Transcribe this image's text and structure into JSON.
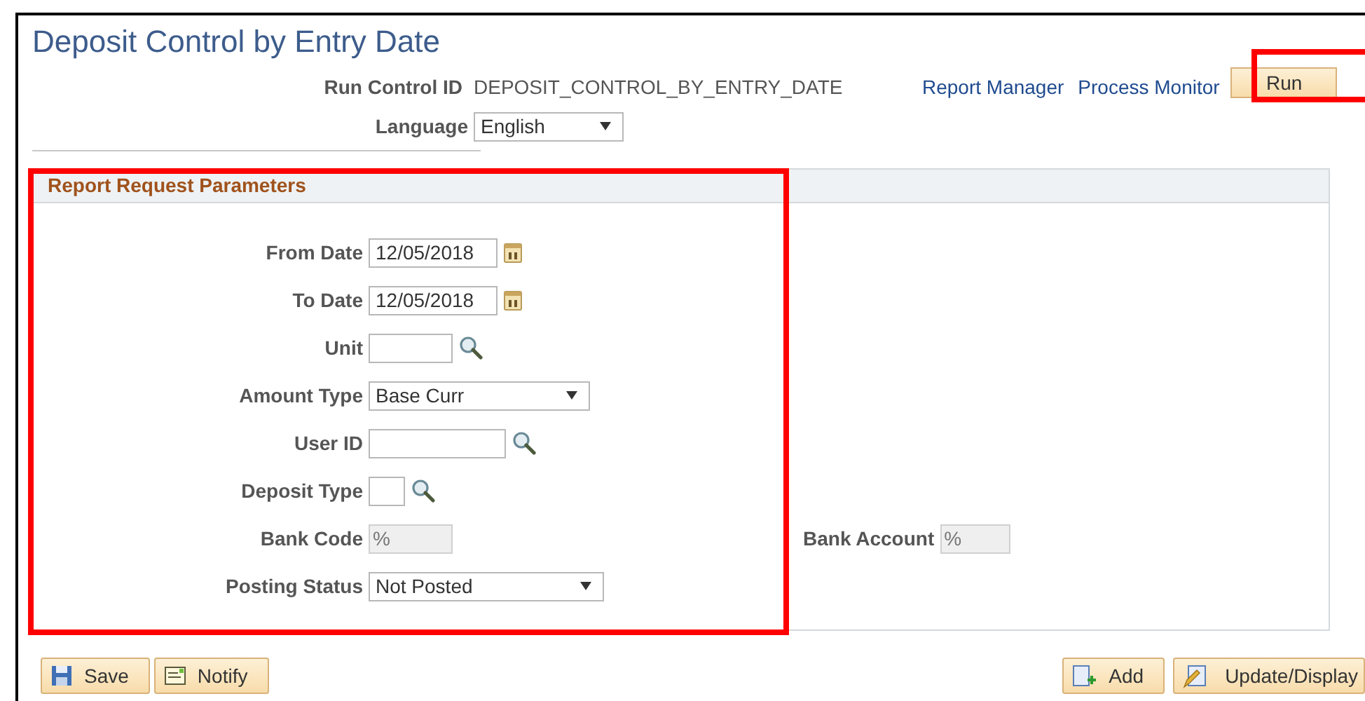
{
  "page": {
    "title": "Deposit Control by Entry Date"
  },
  "run_control": {
    "label": "Run Control ID",
    "value": "DEPOSIT_CONTROL_BY_ENTRY_DATE"
  },
  "links": [
    "Report Manager",
    "Process Monitor"
  ],
  "run_button": {
    "label": "Run"
  },
  "language": {
    "label": "Language",
    "value": "English"
  },
  "panel": {
    "title": "Report Request Parameters",
    "fields": [
      {
        "kind": "date",
        "label": "From Date",
        "value": "12/05/2018"
      },
      {
        "kind": "date",
        "label": "To Date",
        "value": "12/05/2018"
      },
      {
        "kind": "lookup",
        "label": "Unit"
      },
      {
        "kind": "select",
        "label": "Amount Type",
        "value": "Base Curr"
      },
      {
        "kind": "lookup",
        "label": "User ID"
      },
      {
        "kind": "lookup",
        "label": "Deposit Type"
      },
      {
        "kind": "readonly",
        "label": "Bank Code",
        "value": "%",
        "disabled": true,
        "beside": {
          "label": "Bank Account",
          "value": "%",
          "disabled": true
        }
      },
      {
        "kind": "select",
        "label": "Posting Status",
        "value": "Not Posted"
      }
    ]
  },
  "left_buttons": [
    {
      "kind": "save",
      "label": "Save"
    },
    {
      "kind": "notify",
      "label": "Notify"
    }
  ],
  "right_buttons": [
    {
      "kind": "add",
      "label": "Add"
    },
    {
      "kind": "update",
      "label": "Update/Display"
    }
  ]
}
